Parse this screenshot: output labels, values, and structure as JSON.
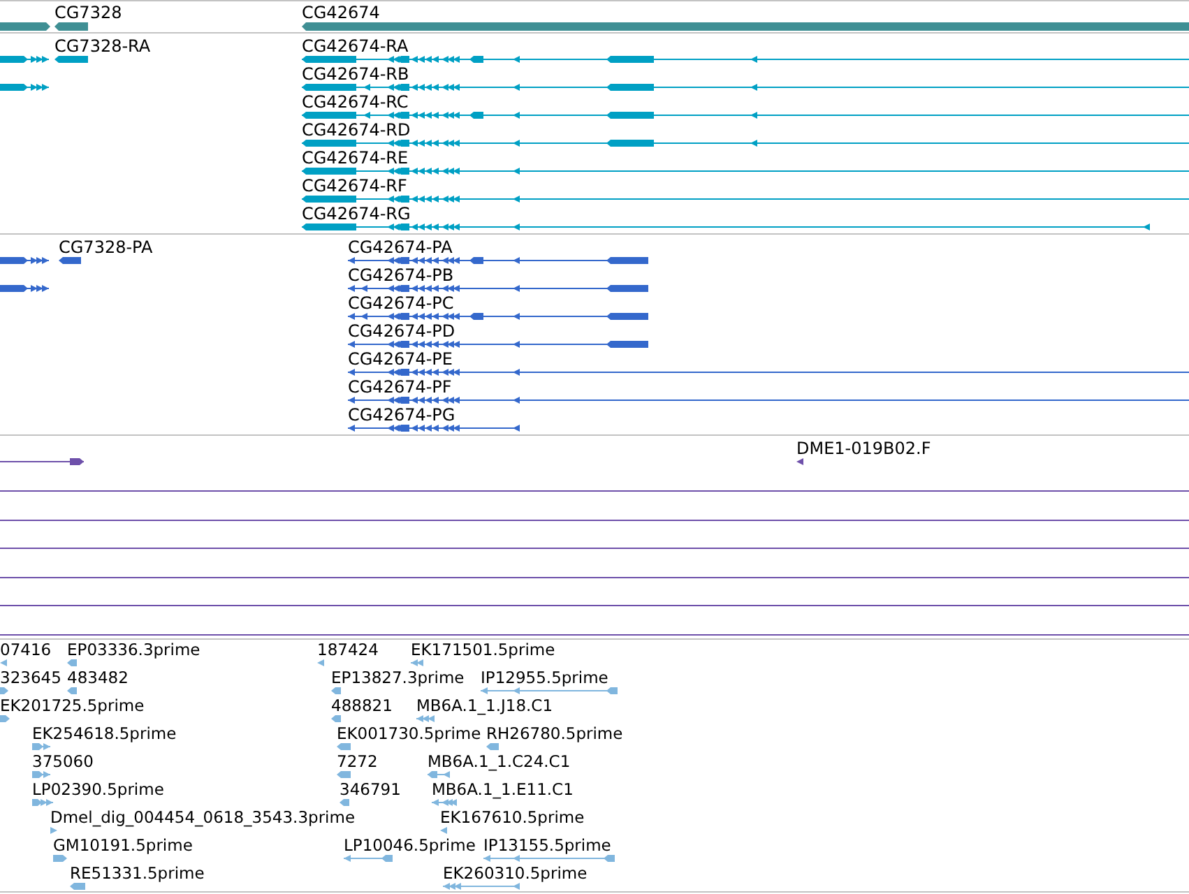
{
  "tracks": [
    {
      "kind": "gene",
      "rows": [
        [
          "CG7328",
          "CG42674"
        ]
      ]
    },
    {
      "kind": "transcript",
      "rows": [
        [
          "CG7328-RA",
          "CG42674-RA"
        ],
        [
          "CG42674-RB"
        ],
        [
          "CG42674-RC"
        ],
        [
          "CG42674-RD"
        ],
        [
          "CG42674-RE"
        ],
        [
          "CG42674-RF"
        ],
        [
          "CG42674-RG"
        ]
      ]
    },
    {
      "kind": "protein",
      "rows": [
        [
          "CG7328-PA",
          "CG42674-PA"
        ],
        [
          "CG42674-PB"
        ],
        [
          "CG42674-PC"
        ],
        [
          "CG42674-PD"
        ],
        [
          "CG42674-PE"
        ],
        [
          "CG42674-PF"
        ],
        [
          "CG42674-PG"
        ]
      ]
    },
    {
      "kind": "clone",
      "rows": [
        [
          "DME1-019B02.F"
        ]
      ]
    },
    {
      "kind": "est",
      "rows": [
        [
          "07416",
          "EP03336.3prime",
          "187424",
          "EK171501.5prime"
        ],
        [
          "323645",
          "483482",
          "EP13827.3prime",
          "IP12955.5prime"
        ],
        [
          "EK201725.5prime",
          "488821",
          "MB6A.1_1.J18.C1"
        ],
        [
          "EK254618.5prime",
          "EK001730.5prime",
          "RH26780.5prime"
        ],
        [
          "375060",
          "7272",
          "MB6A.1_1.C24.C1"
        ],
        [
          "LP02390.5prime",
          "346791",
          "MB6A.1_1.E11.C1"
        ],
        [
          "Dmel_dig_004454_0618_3543.3prime",
          "EK167610.5prime"
        ],
        [
          "GM10191.5prime",
          "LP10046.5prime",
          "IP13155.5prime"
        ],
        [
          "RE51331.5prime",
          "EK260310.5prime"
        ]
      ]
    }
  ]
}
